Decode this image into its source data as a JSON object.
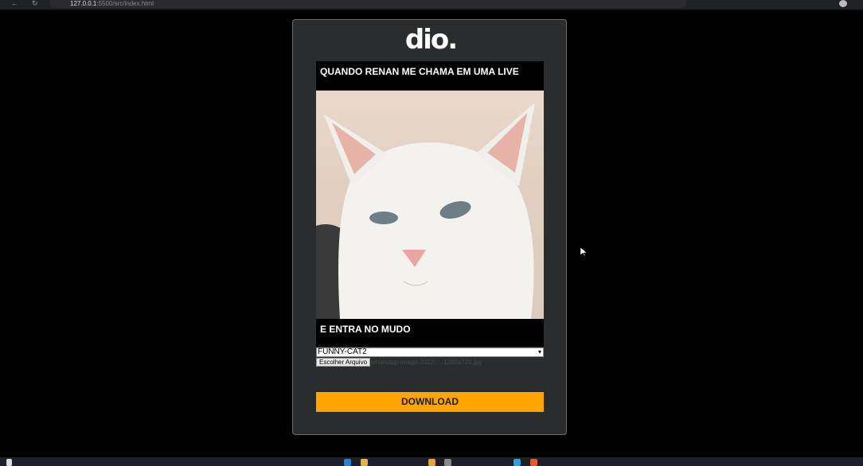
{
  "browser": {
    "url_host": "127.0.0.1",
    "url_path": ":5500/src/index.html"
  },
  "app": {
    "logo_text": "dio.",
    "top_text": "QUANDO RENAN ME CHAMA EM UMA LIVE",
    "bottom_text": "E ENTRA NO MUDO",
    "image_select": {
      "selected": "FUNNY-CAT2"
    },
    "file_button_label": "Escolher Arquivo",
    "file_name": "whatsapp-image-2022-...-1280x720.jpg",
    "download_label": "DOWNLOAD"
  },
  "colors": {
    "accent": "#ffa500",
    "card_bg": "#2a2c2d",
    "page_bg": "#000000"
  }
}
